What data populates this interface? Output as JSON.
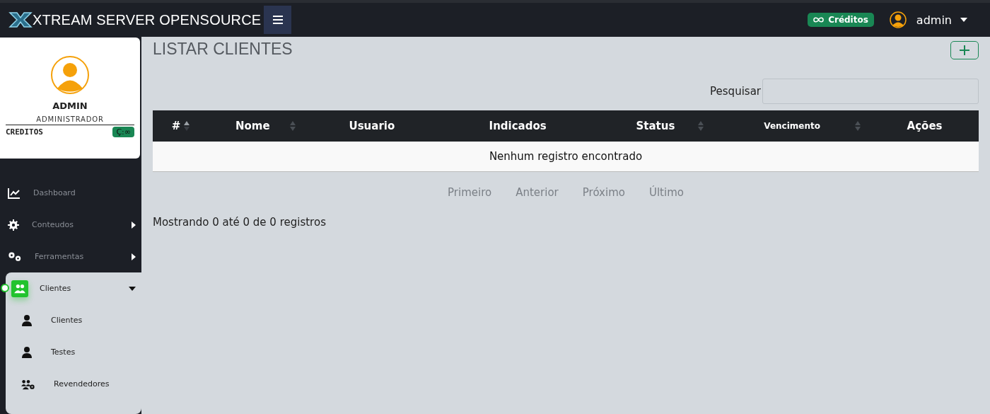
{
  "topbar": {
    "brand": "XTREAM SERVER OPENSOURCE",
    "credits_badge": "Créditos",
    "user": "admin"
  },
  "profile": {
    "name": "ADMIN",
    "role": "ADMINISTRADOR",
    "credits_label": "CREDITOS",
    "credits_value": "Ç:∞"
  },
  "sidebar": {
    "items": [
      {
        "label": "Dashboard",
        "selected": false
      },
      {
        "label": "Conteudos",
        "selected": false,
        "expanded": false
      },
      {
        "label": "Ferramentas",
        "selected": false,
        "expanded": false
      },
      {
        "label": "Clientes",
        "selected": true,
        "expanded": true,
        "children": [
          {
            "label": "Clientes"
          },
          {
            "label": "Testes"
          },
          {
            "label": "Revendedores"
          }
        ]
      }
    ]
  },
  "page": {
    "title": "LISTAR CLIENTES",
    "search_label": "Pesquisar"
  },
  "table": {
    "columns": [
      {
        "label": "#",
        "sortable": true,
        "sorted": true
      },
      {
        "label": "Nome",
        "sortable": true,
        "sorted": false
      },
      {
        "label": "Usuario",
        "sortable": false
      },
      {
        "label": "Indicados",
        "sortable": false
      },
      {
        "label": "Status",
        "sortable": true,
        "sorted": false
      },
      {
        "label": "Vencimento",
        "sortable": true,
        "sorted": false
      },
      {
        "label": "Ações",
        "sortable": false
      }
    ],
    "empty_message": "Nenhum registro encontrado"
  },
  "pagination": [
    "Primeiro",
    "Anterior",
    "Próximo",
    "Último"
  ],
  "info": "Mostrando 0 até 0 de 0 registros"
}
